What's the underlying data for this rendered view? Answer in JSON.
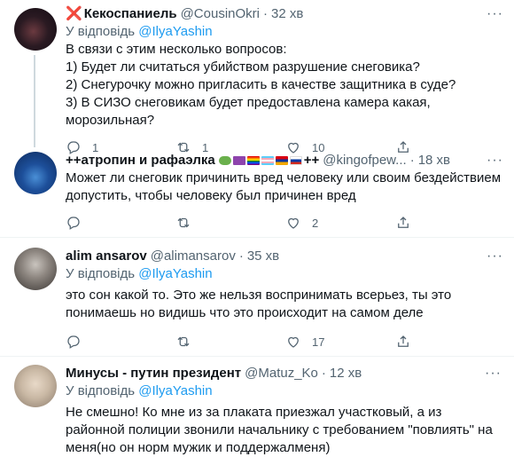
{
  "tweets": [
    {
      "name": "Кекоспаниель",
      "name_prefix": "❌",
      "handle": "@CousinOkri",
      "time": "32 хв",
      "reply_label": "У відповідь",
      "reply_mention": "@IlyaYashin",
      "text": "В связи с этим несколько вопросов:\n1) Будет ли считаться убийством разрушение снеговика?\n2) Снегурочку можно пригласить в качестве защитника в суде?\n3) В СИЗО снеговикам будет предоставлена камера какая, морозильная?",
      "replies": "1",
      "retweets": "1",
      "likes": "10"
    },
    {
      "name": "++атропин и рафаэлка",
      "name_suffix": "++",
      "handle": "@kingofpew...",
      "time": "18 хв",
      "text": "Может ли снеговик причинить вред человеку или своим бездействием допустить, чтобы человеку был причинен вред",
      "replies": "",
      "retweets": "",
      "likes": "2"
    },
    {
      "name": "alim ansarov",
      "handle": "@alimansarov",
      "time": "35 хв",
      "reply_label": "У відповідь",
      "reply_mention": "@IlyaYashin",
      "text": "это сон какой то. Это же нельзя воспринимать всерьез, ты это понимаешь но видишь что это происходит на самом деле",
      "replies": "",
      "retweets": "",
      "likes": "17"
    },
    {
      "name": "Минусы - путин президент",
      "handle": "@Matuz_Ko",
      "time": "12 хв",
      "reply_label": "У відповідь",
      "reply_mention": "@IlyaYashin",
      "text": "Не смешно! Ко мне из за плаката приезжал участковый, а из районной полиции звонили начальнику с требованием \"повлиять\" на меня(но он норм мужик и поддержалменя)"
    }
  ],
  "more_label": "···",
  "colors": {
    "accent": "#1d9bf0",
    "x_mark": "#e0245e"
  }
}
